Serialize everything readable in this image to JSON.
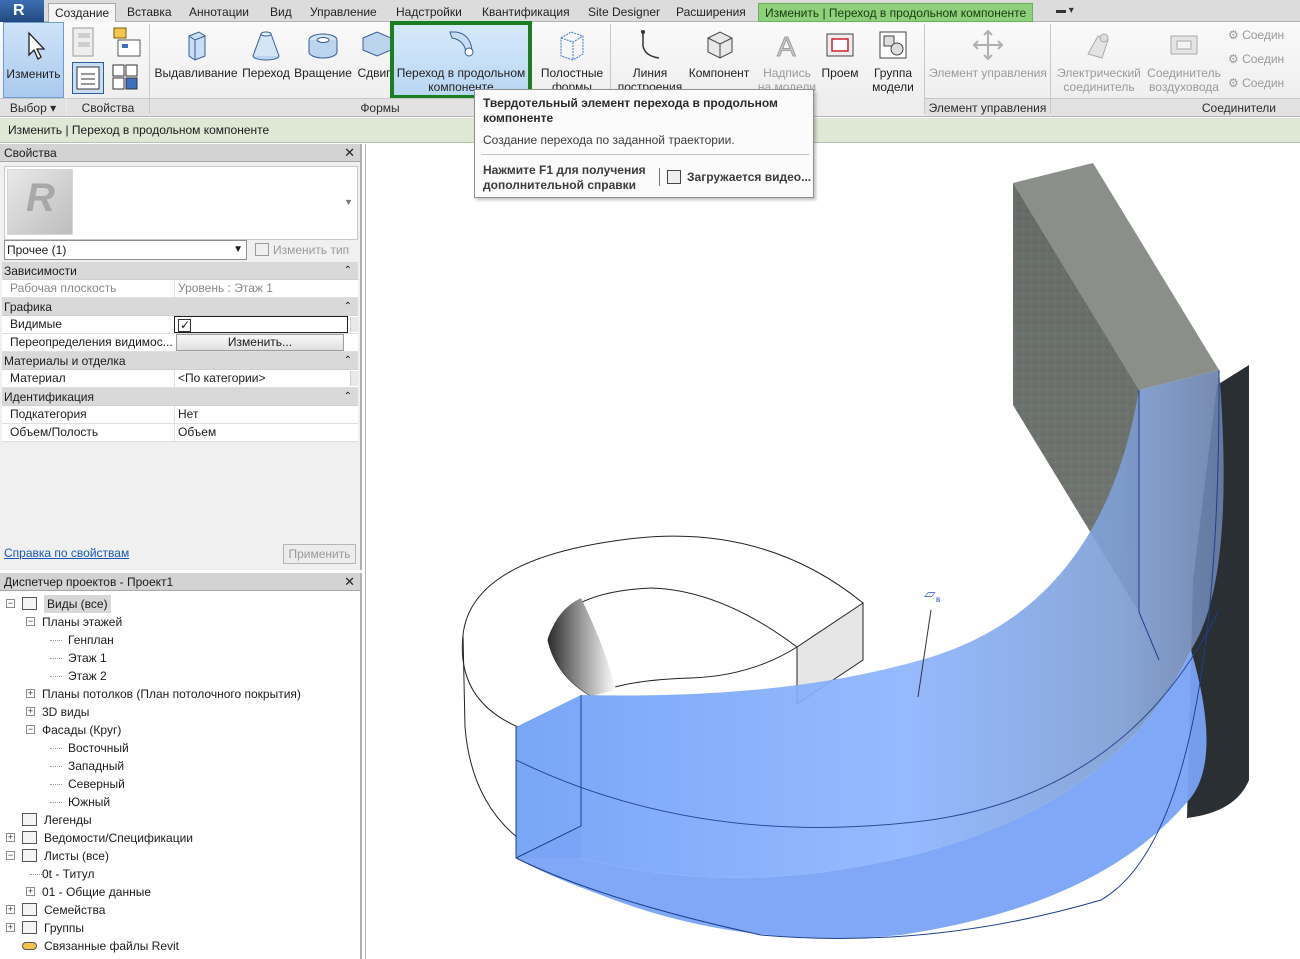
{
  "colors": {
    "accent": "#1b7f21",
    "context_tab": "#8ed07b",
    "selection_blue": "#7fa9ff"
  },
  "tabs": [
    "Создание",
    "Вставка",
    "Аннотации",
    "Вид",
    "Управление",
    "Надстройки",
    "Квантификация",
    "Site Designer",
    "Расширения",
    "Изменить | Переход в продольном компоненте"
  ],
  "ribbon": {
    "select": {
      "modify": "Изменить",
      "panel": "Выбор"
    },
    "properties_panel": "Свойства",
    "forms": {
      "panel": "Формы",
      "extrusion": "Выдавливание",
      "blend": "Переход",
      "revolve": "Вращение",
      "sweep": "Сдвиг",
      "swept_blend_l1": "Переход в продольном",
      "swept_blend_l2": "компоненте",
      "void_l1": "Полостные",
      "void_l2": "формы"
    },
    "datum": {
      "line_l1": "Линия",
      "line_l2": "построения"
    },
    "component": "Компонент",
    "model_text_l1": "Надпись",
    "model_text_l2": "на модели",
    "opening": "Проем",
    "model_group_l1": "Группа",
    "model_group_l2": "модели",
    "control": {
      "button": "Элемент управления",
      "panel": "Элемент управления"
    },
    "connectors": {
      "electrical_l1": "Электрический",
      "electrical_l2": "соединитель",
      "duct_l1": "Соединитель",
      "duct_l2": "воздуховода",
      "small1": "Соедин",
      "small2": "Соедин",
      "small3": "Соедин",
      "panel": "Соединители"
    }
  },
  "options_bar": "Изменить | Переход в продольном компоненте",
  "tooltip": {
    "title": "Твердотельный элемент перехода в продольном компоненте",
    "description": "Создание перехода по заданной траектории.",
    "help": "Нажмите F1 для получения дополнительной справки",
    "video": "Загружается видео..."
  },
  "properties": {
    "header": "Свойства",
    "type_selector": "Прочее (1)",
    "edit_type": "Изменить тип",
    "groups": [
      {
        "name": "Зависимости",
        "rows": [
          {
            "key": "Рабочая плоскость",
            "value": "Уровень : Этаж 1",
            "readonly": true
          }
        ]
      },
      {
        "name": "Графика",
        "rows": [
          {
            "key": "Видимые",
            "value": "",
            "checkbox": true
          },
          {
            "key": "Переопределения видимос...",
            "value": "Изменить...",
            "button": true
          }
        ]
      },
      {
        "name": "Материалы и отделка",
        "rows": [
          {
            "key": "Материал",
            "value": "<По категории>"
          }
        ]
      },
      {
        "name": "Идентификация",
        "rows": [
          {
            "key": "Подкатегория",
            "value": "Нет"
          },
          {
            "key": "Объем/Полость",
            "value": "Объем"
          }
        ]
      }
    ],
    "help_link": "Справка по свойствам",
    "apply": "Применить"
  },
  "project_browser": {
    "header": "Диспетчер проектов - Проект1",
    "tree": [
      {
        "label": "Виды (все)",
        "level": 0,
        "toggle": "-",
        "icon": "views-icon",
        "highlight": true
      },
      {
        "label": "Планы этажей",
        "level": 1,
        "toggle": "-"
      },
      {
        "label": "Генплан",
        "level": 2
      },
      {
        "label": "Этаж 1",
        "level": 2
      },
      {
        "label": "Этаж 2",
        "level": 2
      },
      {
        "label": "Планы потолков (План потолочного покрытия)",
        "level": 1,
        "toggle": "+"
      },
      {
        "label": "3D виды",
        "level": 1,
        "toggle": "+"
      },
      {
        "label": "Фасады (Круг)",
        "level": 1,
        "toggle": "-"
      },
      {
        "label": "Восточный",
        "level": 2
      },
      {
        "label": "Западный",
        "level": 2
      },
      {
        "label": "Северный",
        "level": 2
      },
      {
        "label": "Южный",
        "level": 2
      },
      {
        "label": "Легенды",
        "level": 0,
        "icon": "legend-icon"
      },
      {
        "label": "Ведомости/Спецификации",
        "level": 0,
        "toggle": "+",
        "icon": "schedule-icon"
      },
      {
        "label": "Листы (все)",
        "level": 0,
        "toggle": "-",
        "icon": "sheet-icon"
      },
      {
        "label": "0t - Титул",
        "level": 1
      },
      {
        "label": "01 - Общие данные",
        "level": 1,
        "toggle": "+"
      },
      {
        "label": "Семейства",
        "level": 0,
        "toggle": "+",
        "icon": "family-icon"
      },
      {
        "label": "Группы",
        "level": 0,
        "toggle": "+",
        "icon": "group-icon"
      },
      {
        "label": "Связанные файлы Revit",
        "level": 0,
        "icon": "link-icon"
      }
    ]
  }
}
